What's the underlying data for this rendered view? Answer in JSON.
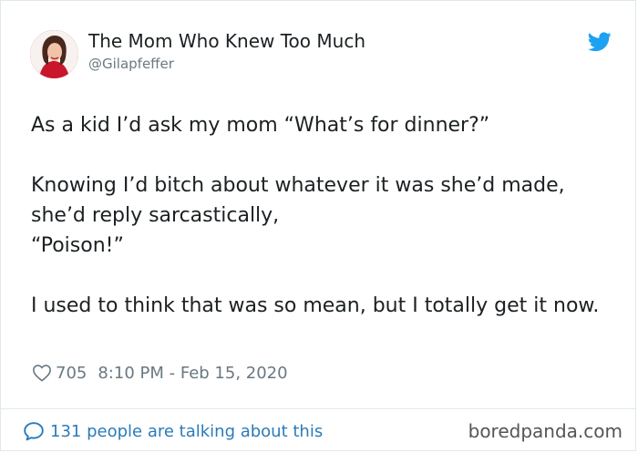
{
  "tweet": {
    "author_name": "The Mom Who Knew Too Much",
    "author_handle": "@Gilapfeffer",
    "text": "As a kid I’d ask my mom “What’s for dinner?”\n\nKnowing I’d bitch about whatever it was she’d made, she’d reply sarcastically,\n“Poison!”\n\nI used to think that was so mean, but I totally get it now.",
    "likes": "705",
    "timestamp": "8:10 PM - Feb 15, 2020",
    "discussion": "131 people are talking about this"
  },
  "watermark": "boredpanda.com",
  "colors": {
    "twitter_blue": "#1da1f2",
    "link_blue": "#2b7bb9",
    "muted_gray": "#697882",
    "divider": "#e1e8ed"
  },
  "icons": {
    "platform": "twitter-bird-icon",
    "like": "heart-outline-icon",
    "conversation": "speech-bubble-icon"
  }
}
